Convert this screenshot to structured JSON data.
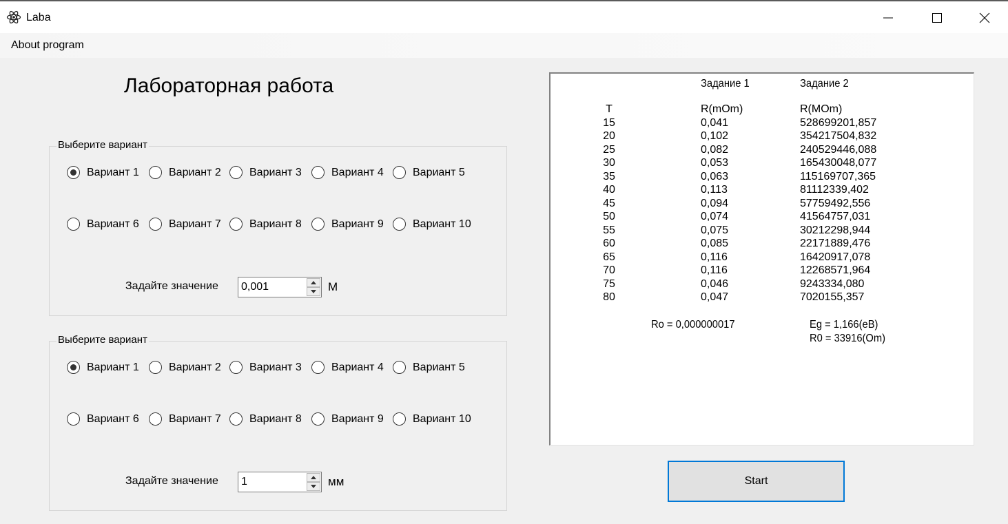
{
  "window": {
    "title": "Laba",
    "icon": "atom-icon",
    "controls": [
      "minimize-icon",
      "maximize-icon",
      "close-icon"
    ]
  },
  "menu": {
    "items": [
      "About program"
    ]
  },
  "heading": "Лабораторная работа",
  "group1": {
    "title": "Выберите вариант",
    "variants": [
      "Вариант 1",
      "Вариант 2",
      "Вариант 3",
      "Вариант 4",
      "Вариант 5",
      "Вариант 6",
      "Вариант 7",
      "Вариант 8",
      "Вариант 9",
      "Вариант 10"
    ],
    "selected": "Вариант 1",
    "value_label": "Задайте значение",
    "value": "0,001",
    "unit": "М"
  },
  "group2": {
    "title": "Выберите вариант",
    "variants": [
      "Вариант 1",
      "Вариант 2",
      "Вариант 3",
      "Вариант 4",
      "Вариант 5",
      "Вариант 6",
      "Вариант 7",
      "Вариант 8",
      "Вариант 9",
      "Вариант 10"
    ],
    "selected": "Вариант 1",
    "value_label": "Задайте значение",
    "value": "1",
    "unit": "мм"
  },
  "output": {
    "task1_header": "Задание 1",
    "task2_header": "Задание 2",
    "col_t_header": "T",
    "col_1_header": "R(mOm)",
    "col_2_header": "R(MOm)",
    "rows": [
      {
        "t": "15",
        "r1": "0,041",
        "r2": "528699201,857"
      },
      {
        "t": "20",
        "r1": "0,102",
        "r2": "354217504,832"
      },
      {
        "t": "25",
        "r1": "0,082",
        "r2": "240529446,088"
      },
      {
        "t": "30",
        "r1": "0,053",
        "r2": "165430048,077"
      },
      {
        "t": "35",
        "r1": "0,063",
        "r2": "115169707,365"
      },
      {
        "t": "40",
        "r1": "0,113",
        "r2": "81112339,402"
      },
      {
        "t": "45",
        "r1": "0,094",
        "r2": "57759492,556"
      },
      {
        "t": "50",
        "r1": "0,074",
        "r2": "41564757,031"
      },
      {
        "t": "55",
        "r1": "0,075",
        "r2": "30212298,944"
      },
      {
        "t": "60",
        "r1": "0,085",
        "r2": "22171889,476"
      },
      {
        "t": "65",
        "r1": "0,116",
        "r2": "16420917,078"
      },
      {
        "t": "70",
        "r1": "0,116",
        "r2": "12268571,964"
      },
      {
        "t": "75",
        "r1": "0,046",
        "r2": "9243334,080"
      },
      {
        "t": "80",
        "r1": "0,047",
        "r2": "7020155,357"
      }
    ],
    "ro_result": "Ro = 0,000000017",
    "eg_result": "Eg = 1,166(eB)",
    "r0_result": "R0 = 33916(Om)"
  },
  "start_button": "Start",
  "colors": {
    "focus_border": "#0078d7",
    "button_face": "#e1e1e1",
    "window_bg": "#f0f0f0"
  }
}
